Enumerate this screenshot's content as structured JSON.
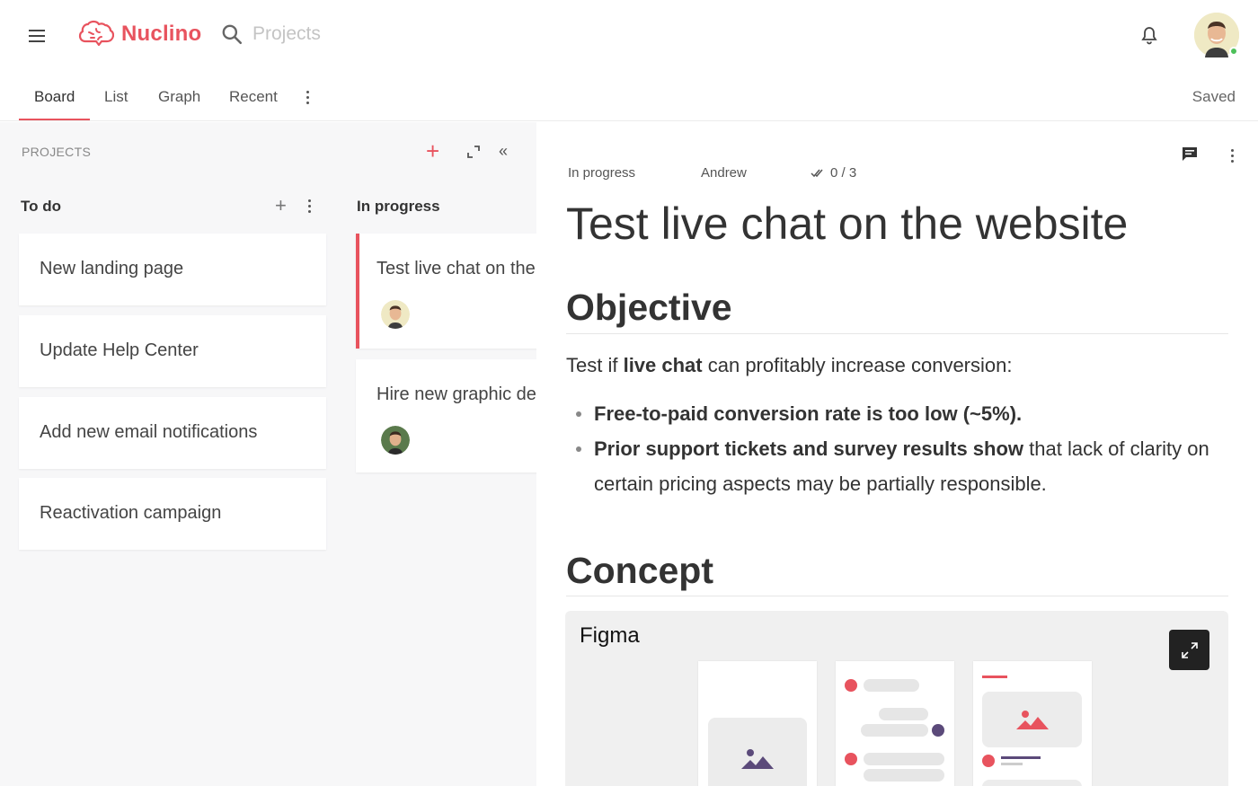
{
  "app": {
    "brand": "Nuclino",
    "brand_color": "#e8535e"
  },
  "search": {
    "placeholder": "Projects"
  },
  "tabs": [
    {
      "label": "Board",
      "active": true
    },
    {
      "label": "List"
    },
    {
      "label": "Graph"
    },
    {
      "label": "Recent"
    }
  ],
  "status": {
    "saved": "Saved"
  },
  "board": {
    "title": "PROJECTS",
    "columns": [
      {
        "title": "To do",
        "cards": [
          {
            "text": "New landing page"
          },
          {
            "text": "Update Help Center"
          },
          {
            "text": "Add new email notifications"
          },
          {
            "text": "Reactivation campaign"
          }
        ]
      },
      {
        "title": "In progress",
        "cards": [
          {
            "text": "Test live chat on the website",
            "selected": true
          },
          {
            "text": "Hire new graphic designer"
          }
        ]
      }
    ]
  },
  "doc": {
    "meta": {
      "status": "In progress",
      "assignee": "Andrew",
      "checklist": "0 / 3"
    },
    "title": "Test live chat on the website",
    "sections": {
      "objective": {
        "heading": "Objective",
        "intro_1": "Test if ",
        "intro_bold": "live chat",
        "intro_2": " can profitably increase conversion:",
        "bullets": [
          {
            "bold": "Free-to-paid conversion rate is too low (~5%).",
            "rest": ""
          },
          {
            "bold": "Prior support tickets and survey results show",
            "rest": " that lack of clarity on certain pricing aspects may be partially responsible."
          }
        ]
      },
      "concept": {
        "heading": "Concept",
        "embed_label": "Figma"
      }
    }
  }
}
